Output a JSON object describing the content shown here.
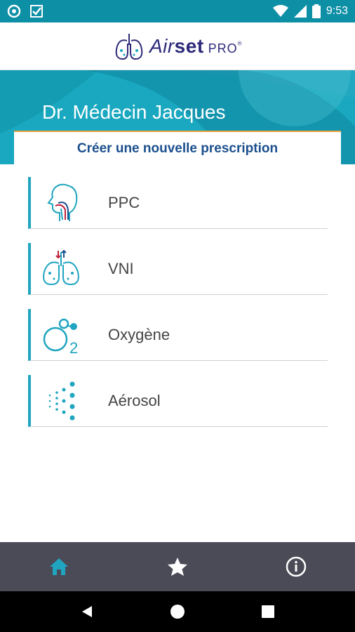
{
  "status_bar": {
    "time": "9:53",
    "battery_level": "8"
  },
  "app": {
    "logo_air": "Air",
    "logo_set": "set",
    "logo_pro": "PRO"
  },
  "header": {
    "doctor_name": "Dr. Médecin Jacques",
    "card_title": "Créer une nouvelle prescription"
  },
  "menu": {
    "items": [
      {
        "label": "PPC",
        "icon": "face-breathing-icon"
      },
      {
        "label": "VNI",
        "icon": "lungs-icon"
      },
      {
        "label": "Oxygène",
        "icon": "oxygen-o2-icon"
      },
      {
        "label": "Aérosol",
        "icon": "aerosol-dots-icon"
      }
    ]
  },
  "bottom_nav": {
    "items": [
      "home-icon",
      "star-icon",
      "info-icon"
    ],
    "active": "home-icon"
  },
  "colors": {
    "teal": "#19a8bf",
    "navy": "#1b4f8e",
    "accent_line": "#e6a23c",
    "nav_bg": "#4b4b57"
  }
}
